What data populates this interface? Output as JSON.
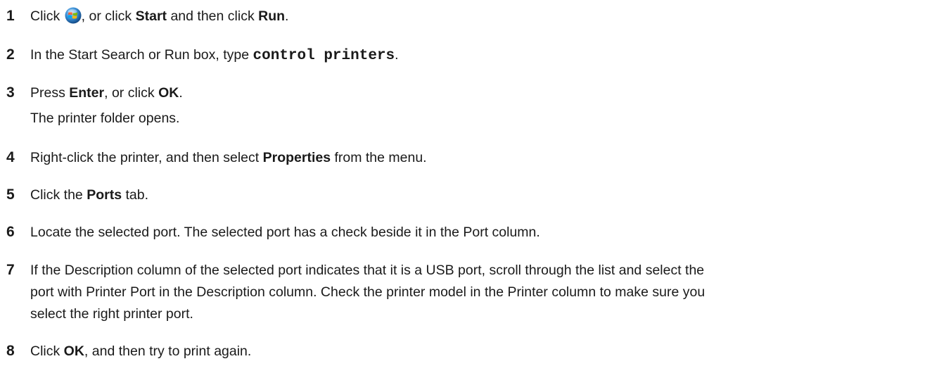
{
  "steps": [
    {
      "number": "1",
      "pre": "Click ",
      "icon": "windows-start-orb-icon",
      "mid": ", or click ",
      "bold1": "Start",
      "mid2": " and then click ",
      "bold2": "Run",
      "post": "."
    },
    {
      "number": "2",
      "pre": "In the Start Search or Run box, type ",
      "code": "control printers",
      "post": "."
    },
    {
      "number": "3",
      "pre": "Press ",
      "bold1": "Enter",
      "mid": ", or click ",
      "bold2": "OK",
      "post": ".",
      "note": "The printer folder opens."
    },
    {
      "number": "4",
      "pre": "Right-click the printer, and then select ",
      "bold1": "Properties",
      "post": " from the menu."
    },
    {
      "number": "5",
      "pre": "Click the ",
      "bold1": "Ports",
      "post": " tab."
    },
    {
      "number": "6",
      "text": "Locate the selected port. The selected port has a check beside it in the Port column."
    },
    {
      "number": "7",
      "line1": "If the Description column of the selected port indicates that it is a USB port, scroll through the list and select the",
      "line2": "port with Printer Port in the Description column. Check the printer model in the Printer column to make sure you",
      "line3": "select the right printer port."
    },
    {
      "number": "8",
      "pre": "Click ",
      "bold1": "OK",
      "post": ", and then try to print again."
    }
  ]
}
